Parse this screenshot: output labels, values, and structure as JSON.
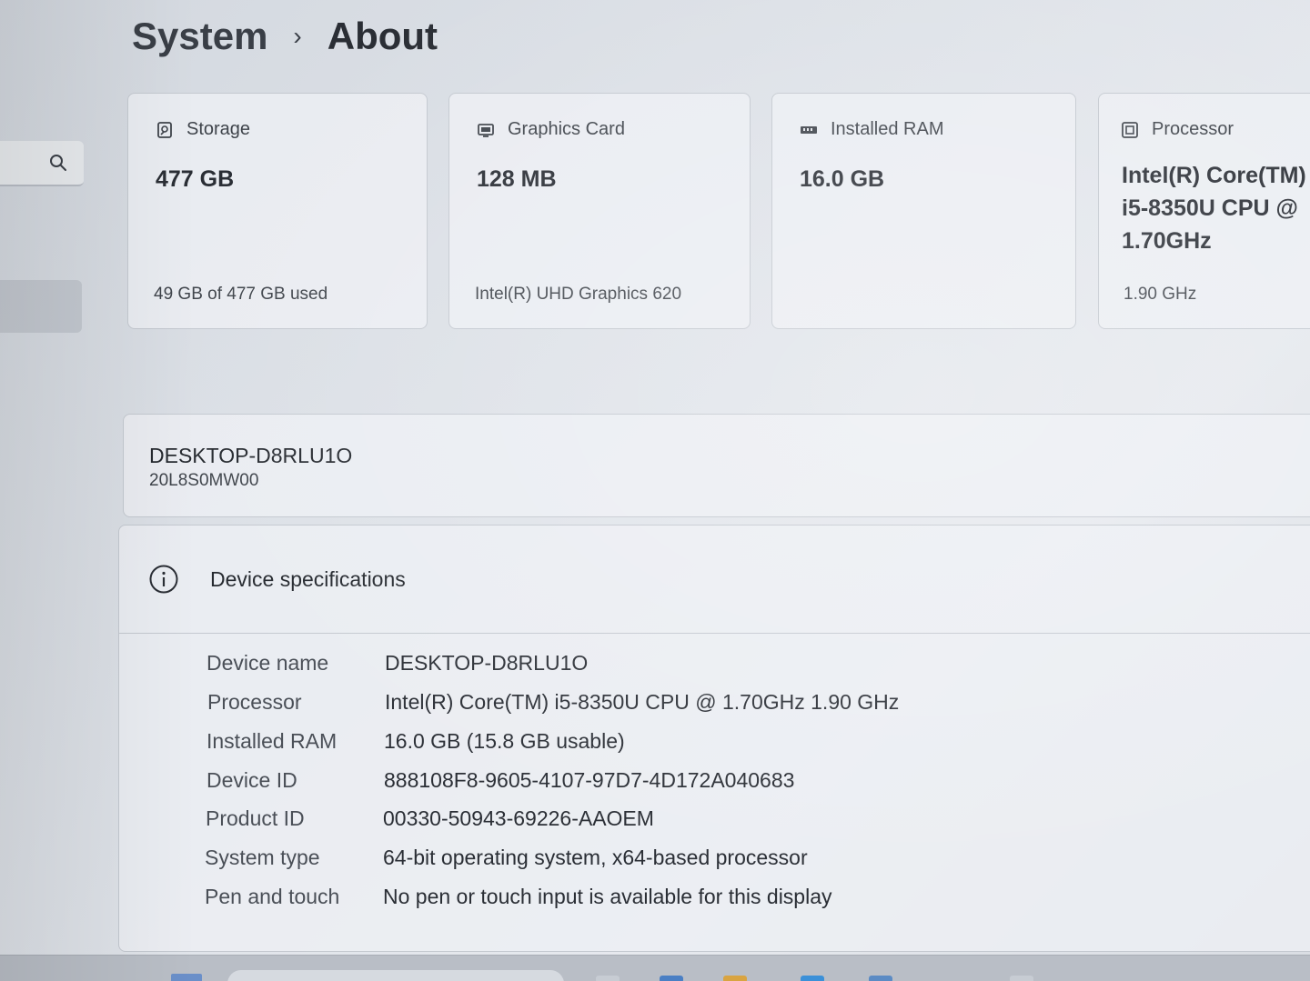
{
  "breadcrumb": {
    "parent": "System",
    "separator": "›",
    "current": "About"
  },
  "sidebar": {
    "search_icon": "search-icon"
  },
  "cards": [
    {
      "icon": "storage-icon",
      "label": "Storage",
      "value": "477 GB",
      "sub": "49 GB of 477 GB used"
    },
    {
      "icon": "graphics-card-icon",
      "label": "Graphics Card",
      "value": "128 MB",
      "sub": "Intel(R) UHD Graphics 620"
    },
    {
      "icon": "ram-icon",
      "label": "Installed RAM",
      "value": "16.0 GB",
      "sub": ""
    },
    {
      "icon": "processor-icon",
      "label": "Processor",
      "value_lines": [
        "Intel(R) Core(TM)",
        "i5-8350U CPU @",
        "1.70GHz"
      ],
      "sub": "1.90 GHz"
    }
  ],
  "device": {
    "name": "DESKTOP-D8RLU1O",
    "model": "20L8S0MW00"
  },
  "specs": {
    "icon": "info-icon",
    "title": "Device specifications",
    "rows": [
      {
        "label": "Device name",
        "value": "DESKTOP-D8RLU1O"
      },
      {
        "label": "Processor",
        "value": "Intel(R) Core(TM) i5-8350U CPU @ 1.70GHz   1.90 GHz"
      },
      {
        "label": "Installed RAM",
        "value": "16.0 GB (15.8 GB usable)"
      },
      {
        "label": "Device ID",
        "value": "888108F8-9605-4107-97D7-4D172A040683"
      },
      {
        "label": "Product ID",
        "value": "00330-50943-69226-AAOEM"
      },
      {
        "label": "System type",
        "value": "64-bit operating system, x64-based processor"
      },
      {
        "label": "Pen and touch",
        "value": "No pen or touch input is available for this display"
      }
    ]
  }
}
